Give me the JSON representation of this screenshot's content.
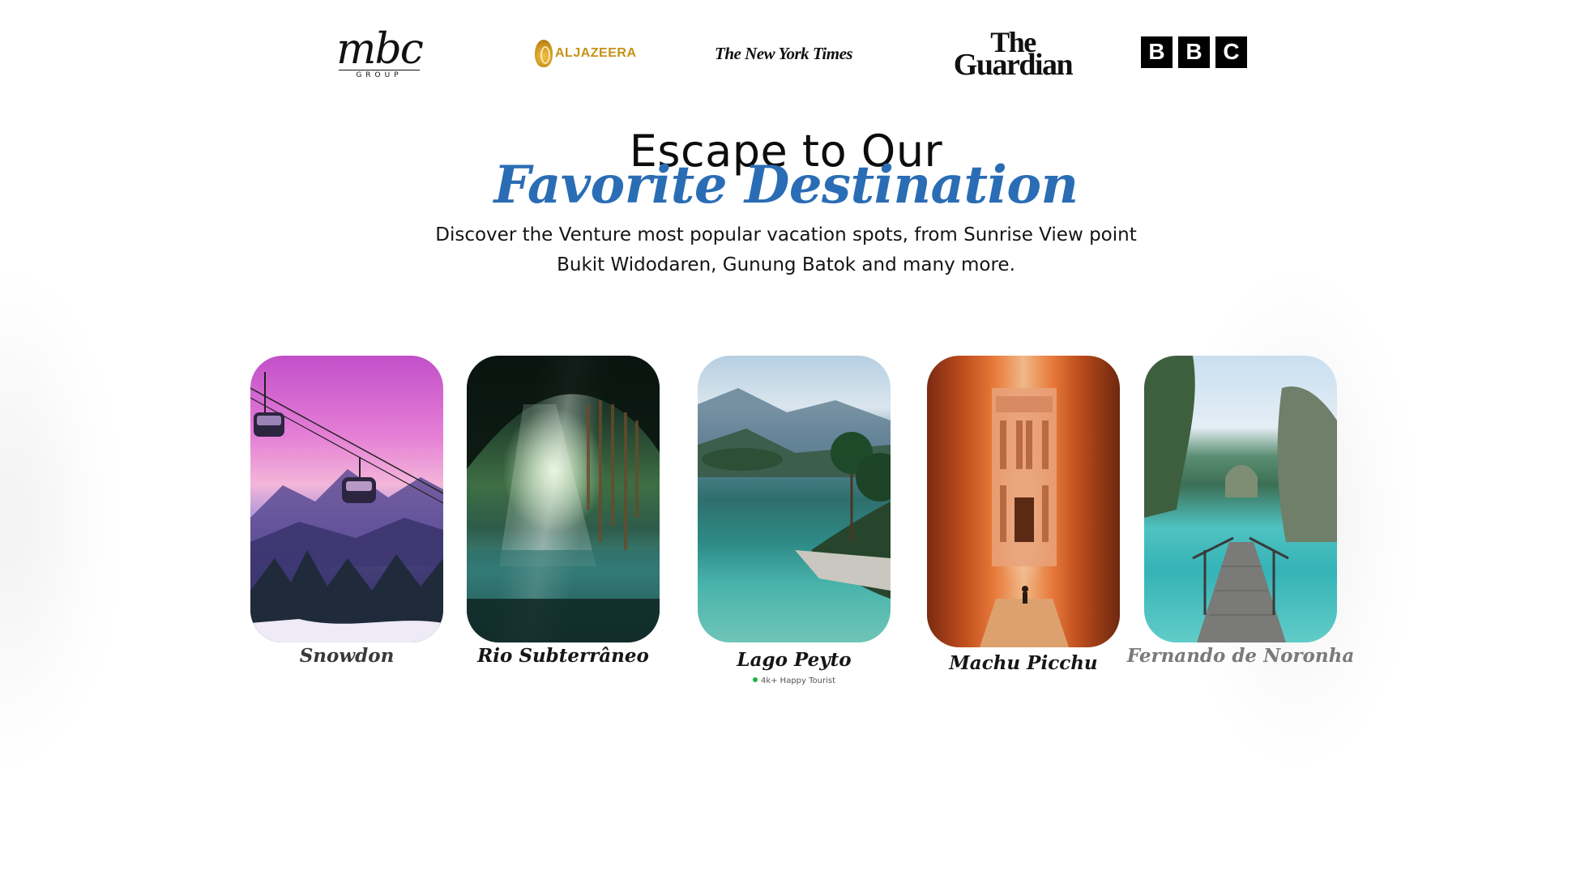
{
  "logos": {
    "mbc": {
      "mark": "mbc",
      "sub": "GROUP"
    },
    "aljazeera": {
      "text": "ALJAZEERA"
    },
    "nyt": {
      "text": "The New York Times"
    },
    "guardian": {
      "line1": "The",
      "line2": "Guardian"
    },
    "bbc": {
      "letters": [
        "B",
        "B",
        "C"
      ]
    }
  },
  "headline": {
    "line1": "Escape to Our",
    "line2": "Favorite Destination"
  },
  "subtitle": {
    "line1": "Discover the Venture most popular vacation spots, from Sunrise View point",
    "line2": "Bukit Widodaren, Gunung Batok and many more."
  },
  "destinations": [
    {
      "name": "Snowdon"
    },
    {
      "name": "Rio Subterrâneo"
    },
    {
      "name": "Lago Peyto",
      "tag": "4k+ Happy Tourist"
    },
    {
      "name": "Machu Picchu"
    },
    {
      "name": "Fernando de Noronha"
    }
  ],
  "colors": {
    "accent_blue": "#2a6db5",
    "aljazeera_gold": "#c69216",
    "status_green": "#18b844"
  }
}
